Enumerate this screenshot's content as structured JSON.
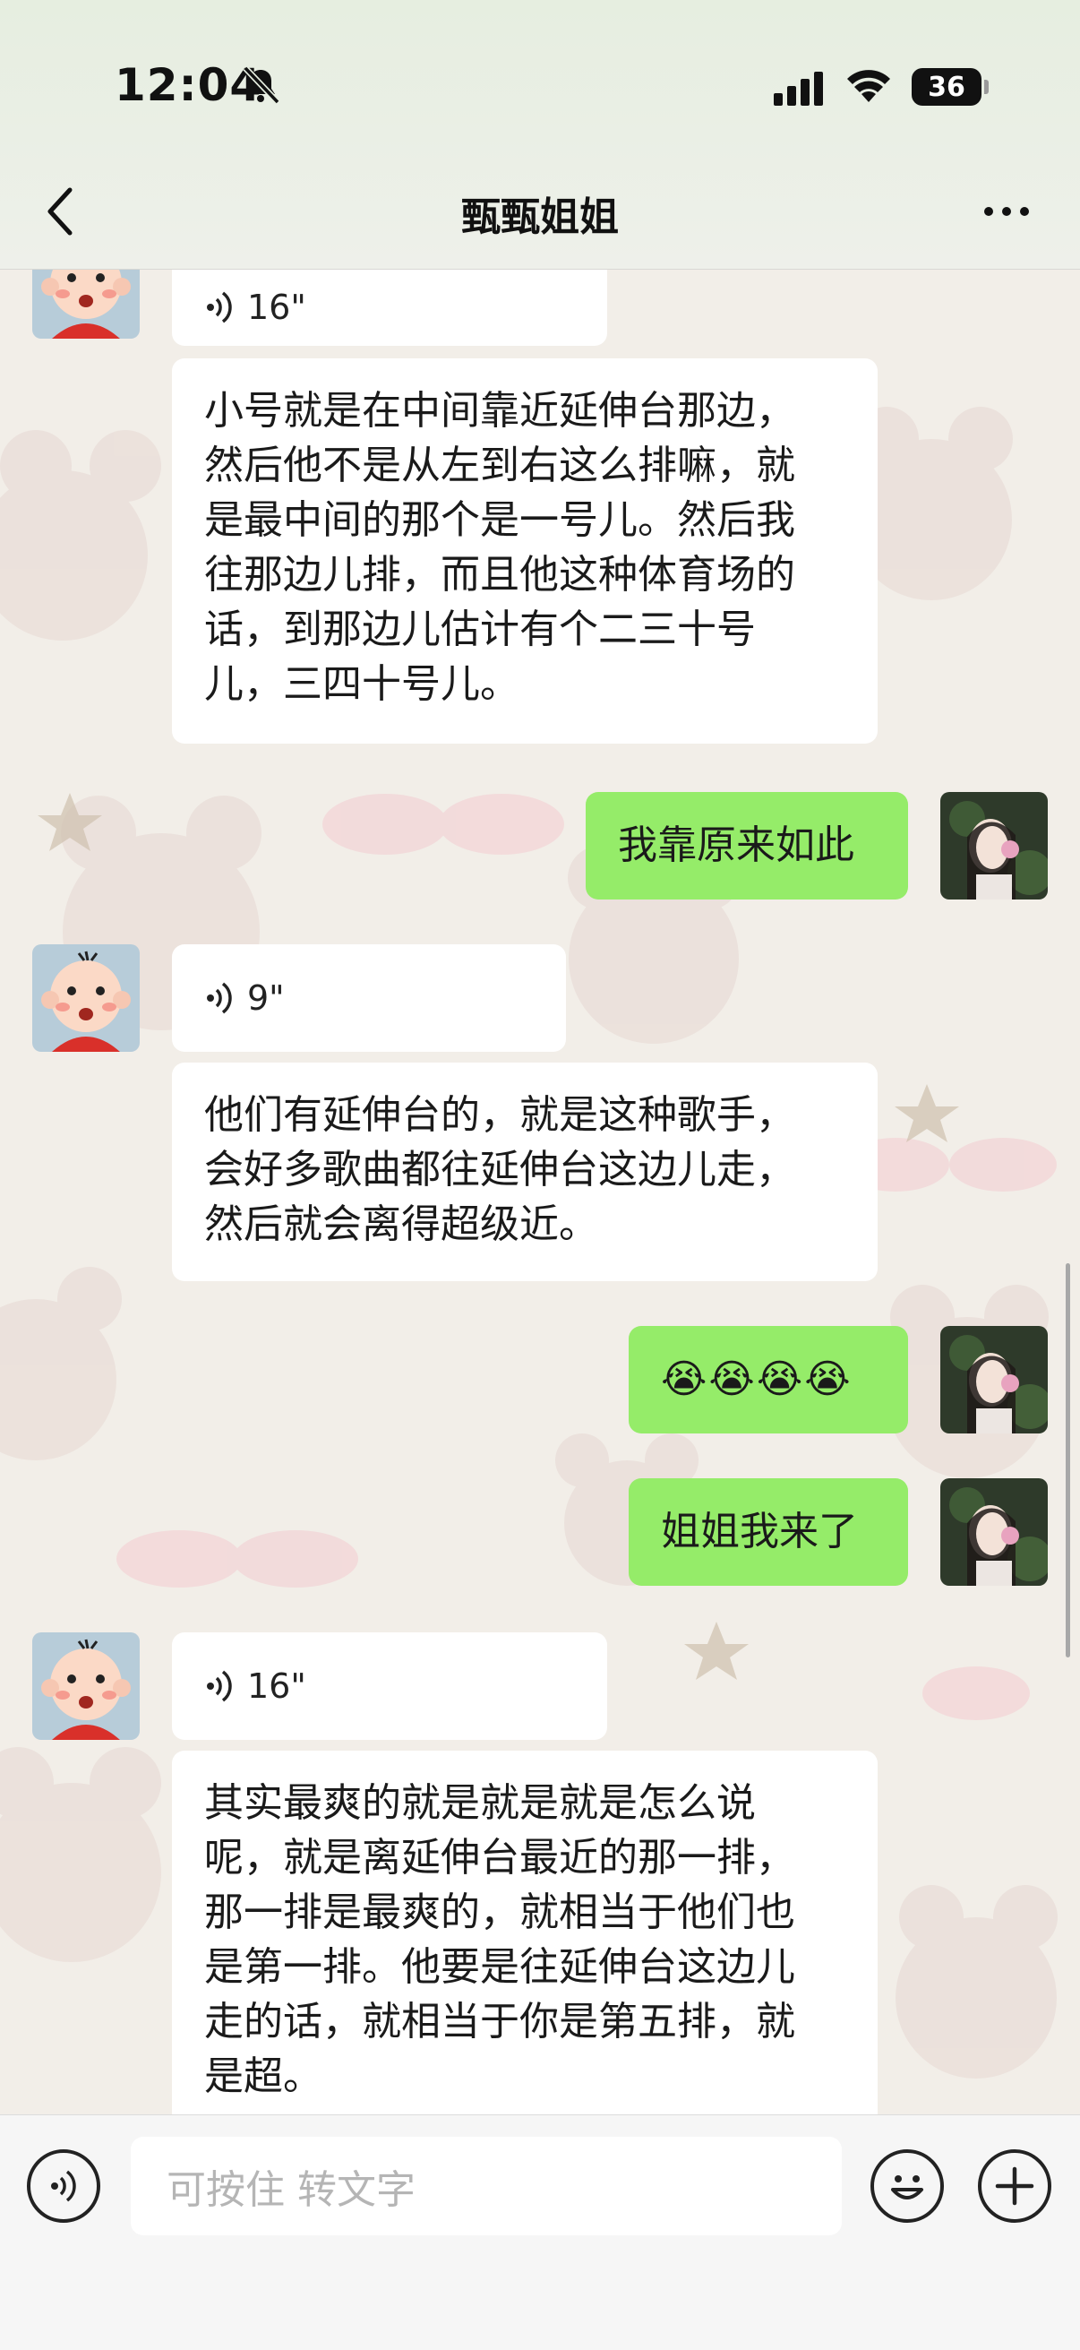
{
  "status_bar": {
    "time": "12:04",
    "battery": "36"
  },
  "header": {
    "title": "甄甄姐姐"
  },
  "messages": [
    {
      "side": "left",
      "type": "voice",
      "duration": "16\""
    },
    {
      "side": "left",
      "type": "text",
      "text": "小号就是在中间靠近延伸台那边，\n然后他不是从左到右这么排嘛，就\n是最中间的那个是一号儿。然后我\n往那边儿排，而且他这种体育场的\n话，到那边儿估计有个二三十号\n儿，三四十号儿。"
    },
    {
      "side": "right",
      "type": "text",
      "text": "我靠原来如此"
    },
    {
      "side": "left",
      "type": "voice",
      "duration": "9\""
    },
    {
      "side": "left",
      "type": "text",
      "text": "他们有延伸台的，就是这种歌手，\n会好多歌曲都往延伸台这边儿走，\n然后就会离得超级近。"
    },
    {
      "side": "right",
      "type": "text",
      "text": "😭😭😭😭"
    },
    {
      "side": "right",
      "type": "text",
      "text": "姐姐我来了"
    },
    {
      "side": "left",
      "type": "voice",
      "duration": "16\""
    },
    {
      "side": "left",
      "type": "text",
      "text": "其实最爽的就是就是就是怎么说\n呢，就是离延伸台最近的那一排，\n那一排是最爽的，就相当于他们也\n是第一排。他要是往延伸台这边儿\n走的话，就相当于你是第五排，就\n是超。"
    }
  ],
  "input_bar": {
    "placeholder": "可按住 转文字"
  },
  "colors": {
    "sent_bubble": "#95ec69",
    "received_bubble": "#ffffff"
  },
  "icons": [
    "bell-slash-icon",
    "signal-icon",
    "wifi-icon",
    "battery-icon",
    "back-chevron-icon",
    "more-icon",
    "voice-wave-icon",
    "emoji-icon",
    "plus-icon"
  ]
}
